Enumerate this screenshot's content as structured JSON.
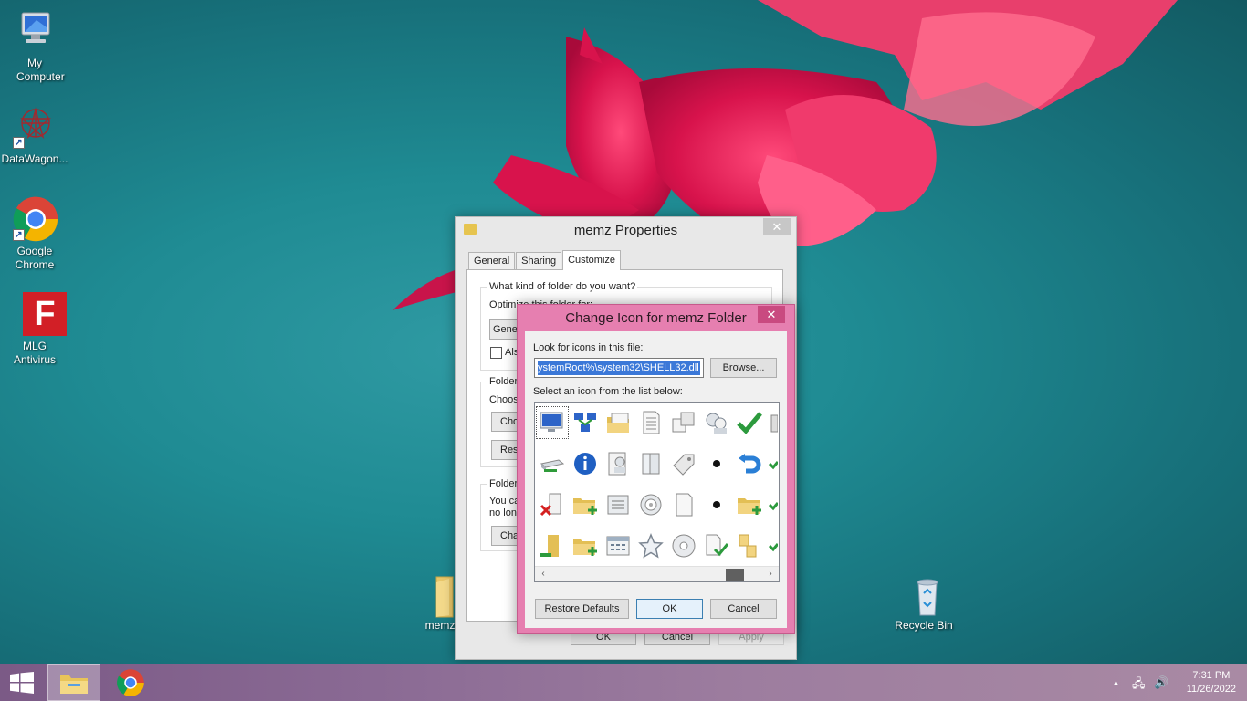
{
  "desktop": {
    "icons": [
      {
        "label": "My Computer"
      },
      {
        "label": "DataWagon..."
      },
      {
        "label": "Google Chrome"
      },
      {
        "label": "MLG Antivirus"
      },
      {
        "label": "memz"
      },
      {
        "label": "Recycle Bin"
      }
    ],
    "mlg_logo_text": "F"
  },
  "properties_dialog": {
    "title": "memz Properties",
    "close_glyph": "✕",
    "tabs": [
      {
        "label": "General"
      },
      {
        "label": "Sharing"
      },
      {
        "label": "Customize"
      }
    ],
    "active_tab": "Customize",
    "folder_type_group": {
      "heading": "What kind of folder do you want?",
      "optimize_partial": "Optimize this folder for:",
      "dropdown_partial": "Gene",
      "checkbox_partial": "Als"
    },
    "folder_pictures_group": {
      "heading_partial": "Folder",
      "choose_partial": "Choos",
      "button_partial": "Cho",
      "restore_partial": "Res"
    },
    "folder_icons_group": {
      "heading_partial": "Folder",
      "line1_partial": "You ca",
      "line2_partial": "no lon",
      "button_partial": "Cha"
    },
    "buttons": {
      "ok": "OK",
      "cancel": "Cancel",
      "apply": "Apply"
    }
  },
  "change_icon_dialog": {
    "title": "Change Icon for memz Folder",
    "close_glyph": "✕",
    "look_label": "Look for icons in this file:",
    "path_value": "ystemRoot%\\system32\\SHELL32.dll",
    "browse_label": "Browse...",
    "select_label": "Select an icon from the list below:",
    "icons": [
      [
        "computer-icon",
        "network-icon",
        "folder-stack-icon",
        "document-icon",
        "window-icon",
        "users-icon",
        "checkmark-icon",
        "partial-icon"
      ],
      [
        "drive-icon",
        "info-icon",
        "user-icon",
        "book-icon",
        "tag-icon",
        "dot-icon",
        "undo-icon",
        "check-partial-icon"
      ],
      [
        "delete-icon",
        "folder-add-icon",
        "list-icon",
        "disc-icon",
        "blank-page-icon",
        "dot-icon",
        "folder-add-icon",
        "check-partial-icon"
      ],
      [
        "folder-user-icon",
        "folder-add-icon",
        "calendar-icon",
        "star-icon",
        "cd-icon",
        "page-check-icon",
        "folders-icon",
        "check-partial-icon"
      ]
    ],
    "scroll_left": "‹",
    "scroll_right": "›",
    "buttons": {
      "restore": "Restore Defaults",
      "ok": "OK",
      "cancel": "Cancel"
    }
  },
  "taskbar": {
    "tray": {
      "up_arrow": "▲",
      "network": "🖧",
      "volume": "🔊"
    },
    "clock_time": "7:31 PM",
    "clock_date": "11/26/2022"
  }
}
